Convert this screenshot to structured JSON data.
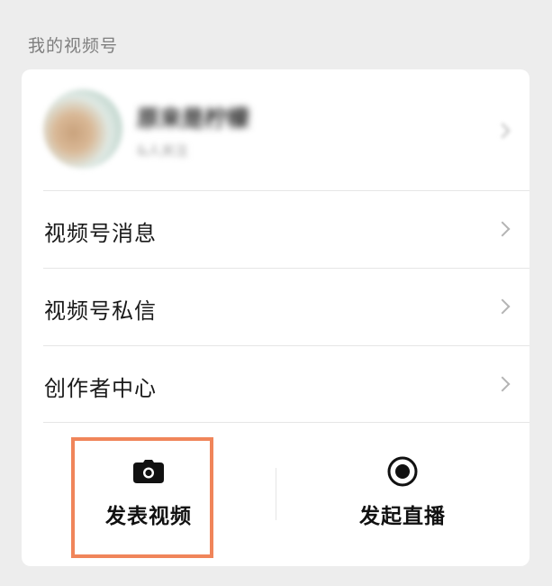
{
  "section": {
    "title": "我的视频号"
  },
  "profile": {
    "name": "原来是柠檬",
    "subtitle": "&人关注"
  },
  "menu": {
    "items": [
      {
        "label": "视频号消息"
      },
      {
        "label": "视频号私信"
      },
      {
        "label": "创作者中心"
      }
    ]
  },
  "actions": {
    "publish_label": "发表视频",
    "live_label": "发起直播"
  },
  "icons": {
    "publish": "camera-icon",
    "live": "record-icon",
    "chevron": "chevron-right-icon"
  },
  "colors": {
    "highlight": "#f0855a",
    "background": "#ededed",
    "card": "#ffffff"
  }
}
